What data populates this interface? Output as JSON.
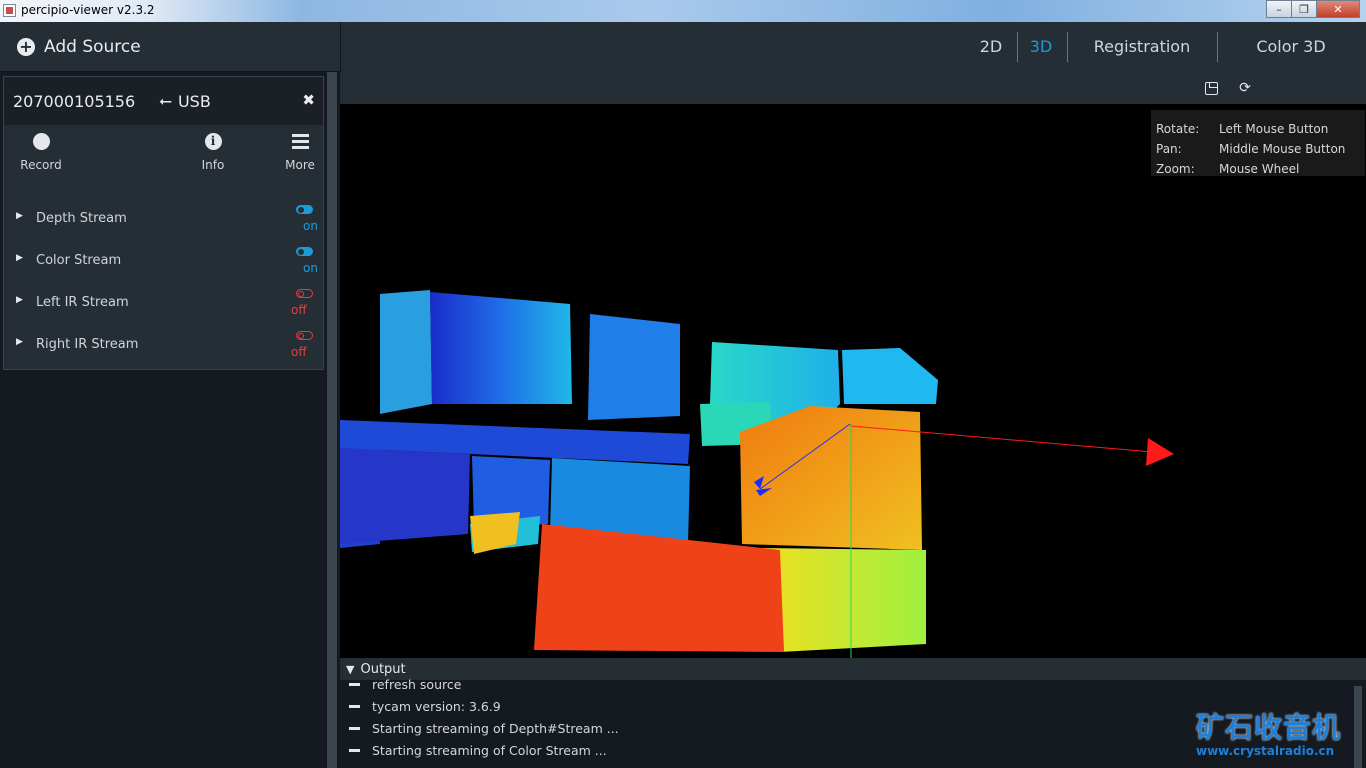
{
  "window": {
    "title": "percipio-viewer v2.3.2",
    "minimize": "–",
    "restore": "❐",
    "close": "✕"
  },
  "sidebar": {
    "add_source_label": "Add Source",
    "device": {
      "serial": "207000105156",
      "usb_symbol": "⭠",
      "connection": "USB",
      "close_symbol": "✖",
      "actions": [
        {
          "label": "Record",
          "icon": "record-icon"
        },
        {
          "label": "Info",
          "icon": "info-icon",
          "glyph": "i"
        },
        {
          "label": "More",
          "icon": "menu-icon"
        }
      ],
      "streams": [
        {
          "name": "Depth Stream",
          "state": "on"
        },
        {
          "name": "Color Stream",
          "state": "on"
        },
        {
          "name": "Left IR Stream",
          "state": "off"
        },
        {
          "name": "Right IR Stream",
          "state": "off"
        }
      ],
      "caret": "▶"
    }
  },
  "tabs": [
    {
      "label": "2D",
      "active": false
    },
    {
      "label": "3D",
      "active": true
    },
    {
      "label": "Registration",
      "active": false
    },
    {
      "label": "Color 3D",
      "active": false
    }
  ],
  "toolbar": {
    "refresh_symbol": "⟳"
  },
  "help": [
    {
      "key": "Rotate:",
      "value": "Left Mouse Button"
    },
    {
      "key": "Pan:",
      "value": "Middle Mouse Button"
    },
    {
      "key": "Zoom:",
      "value": "Mouse Wheel"
    }
  ],
  "output": {
    "title": "Output",
    "toggle_symbol": "▼",
    "logs": [
      "refresh source",
      "tycam version: 3.6.9",
      "Starting streaming of Depth#Stream ...",
      "Starting streaming of Color Stream ..."
    ]
  },
  "watermark": {
    "title": "矿石收音机",
    "url": "www.crystalradio.cn"
  },
  "colors": {
    "accent": "#1d9bd9",
    "off": "#e04040",
    "panel": "#262e35"
  }
}
